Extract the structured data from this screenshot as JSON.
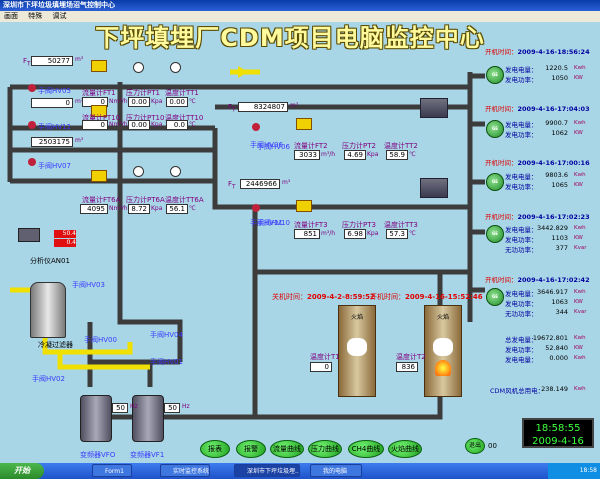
{
  "window": {
    "title": "深圳市下坪垃圾填埋场沼气控制中心"
  },
  "menu": [
    "画面",
    "特殊",
    "调试"
  ],
  "main_title": "下坪填埋厂CDM项目电脑监控中心",
  "flows": [
    {
      "value": "50277",
      "unit": "m³"
    },
    {
      "value": "0",
      "unit": "m³"
    },
    {
      "value": "2503175",
      "unit": "m³"
    }
  ],
  "left_valves": [
    "手阀HV05",
    "手阀HV12",
    "手阀HV07"
  ],
  "meter_rows": [
    {
      "flow_label": "流量计FT1",
      "flow": "0",
      "flow_unit": "Nm³/h",
      "press_label": "压力计PT1",
      "press": "0.00",
      "press_unit": "Kpa",
      "temp_label": "温度计TT1",
      "temp": "0.00",
      "temp_unit": "℃"
    },
    {
      "flow_label": "流量计FT10",
      "flow": "0",
      "flow_unit": "Nm³/h",
      "press_label": "压力计PT10",
      "press": "0.00",
      "press_unit": "Kpa",
      "temp_label": "温度计TT10",
      "temp": "0.0",
      "temp_unit": "℃"
    },
    {
      "flow_label": "流量计FT6A",
      "flow": "4095",
      "flow_unit": "Nm³/h",
      "press_label": "压力计PT6A",
      "press": "8.72",
      "press_unit": "Kpa",
      "temp_label": "温度计TT6A",
      "temp": "56.1",
      "temp_unit": "℃"
    }
  ],
  "center_flows": [
    {
      "value": "8324807",
      "unit": "m³"
    },
    {
      "value": "2446966",
      "unit": "m³"
    }
  ],
  "center_meters": [
    {
      "valve": "手阀HV06",
      "flow_label": "流量计FT2",
      "flow": "3033",
      "flow_unit": "m³/h",
      "press_label": "压力计PT2",
      "press": "4.69",
      "press_unit": "Kpa",
      "temp_label": "温度计TT2",
      "temp": "58.9",
      "temp_unit": "℃"
    },
    {
      "valve": "手阀HV10",
      "flow_label": "流量计FT3",
      "flow": "851",
      "flow_unit": "m³/h",
      "press_label": "压力计PT3",
      "press": "6.98",
      "press_unit": "Kpa",
      "temp_label": "温度计TT3",
      "temp": "57.3",
      "temp_unit": "℃"
    }
  ],
  "generators": [
    {
      "start_label": "开机时间：",
      "start_time": "2009-4-16-18:56:24",
      "p_label": "发电电量：",
      "energy": "1220.5",
      "e_unit": "Kwh",
      "pw_label": "发电功率：",
      "power": "1050",
      "pw_unit": "KW",
      "icon": "GE"
    },
    {
      "start_label": "开机时间：",
      "start_time": "2009-4-16-17:04:03",
      "p_label": "发电电量：",
      "energy": "9900.7",
      "e_unit": "Kwh",
      "pw_label": "发电功率：",
      "power": "1062",
      "pw_unit": "KW",
      "icon": "GE"
    },
    {
      "start_label": "开机时间：",
      "start_time": "2009-4-16-17:00:16",
      "p_label": "发电电量：",
      "energy": "9803.6",
      "e_unit": "Kwh",
      "pw_label": "发电功率：",
      "power": "1065",
      "pw_unit": "KW",
      "icon": "GE"
    },
    {
      "start_label": "开机时间：",
      "start_time": "2009-4-16-17:02:23",
      "p_label": "发电电量：",
      "energy": "3442.829",
      "e_unit": "Kwh",
      "pw_label": "发电功率：",
      "power": "1103",
      "pw_unit": "KW",
      "q_label": "无功功率：",
      "qpower": "377",
      "q_unit": "Kvar",
      "icon": "GE"
    },
    {
      "start_label": "开机时间：",
      "start_time": "2009-4-16-17:02:42",
      "p_label": "发电电量：",
      "energy": "3646.917",
      "e_unit": "Kwh",
      "pw_label": "发电功率：",
      "power": "1063",
      "pw_unit": "KW",
      "q_label": "无功功率：",
      "qpower": "344",
      "q_unit": "Kvar",
      "icon": "GE"
    }
  ],
  "totals": [
    {
      "label": "总发电量：",
      "value": "19672.801",
      "unit": "Kwh"
    },
    {
      "label": "发电功率：",
      "value": "52.840",
      "unit": "KW"
    },
    {
      "label": "发电电量：",
      "value": "0.000",
      "unit": "Kwh"
    }
  ],
  "cdm_total": {
    "label": "CDM风机总用电：",
    "value": "238.149",
    "unit": "Kwh"
  },
  "flares": [
    {
      "time_label": "关机时间：",
      "time": "2009-4-2-8:59:52",
      "temp_label": "温度计T1",
      "temp": "0",
      "status_label": "火焰"
    },
    {
      "time_label": "开机时间：",
      "time": "2009-4-16-15:52:46",
      "temp_label": "温度计T2",
      "temp": "836",
      "status_label": "火焰"
    }
  ],
  "analyzer": {
    "label": "分析仪AN01",
    "value1": "50.4",
    "value2": "0.4"
  },
  "filter_label": "冷凝过滤器",
  "feed_valve": "手阀HV02",
  "mid_valves": [
    "手阀HV03",
    "手阀HV04",
    "手阀HV01",
    "手阀HV00",
    "手阀HV06",
    "手阀HV11"
  ],
  "fans": [
    {
      "label": "变频器VFO",
      "value": "50",
      "unit": "Hz"
    },
    {
      "label": "变频器VF1",
      "value": "50",
      "unit": "Hz"
    }
  ],
  "bottom_buttons": [
    "报表",
    "报警",
    "流量曲线",
    "压力曲线",
    "CH4曲线",
    "火焰曲线"
  ],
  "exit": {
    "label": "退出",
    "value": "00"
  },
  "clock": {
    "time": "18:58:55",
    "date": "2009-4-16"
  },
  "taskbar": {
    "start": "开始",
    "items": [
      "Form1",
      "实时监控系统",
      "深圳市下坪垃圾埋...",
      "我的电脑"
    ],
    "tray_time": "18:58"
  },
  "colors": {
    "background": "#a8d6e6",
    "pipe": "#3c3c3c",
    "title": "#fffb9c",
    "button": "#2fbf2f",
    "clock_text": "#3cff3c"
  }
}
